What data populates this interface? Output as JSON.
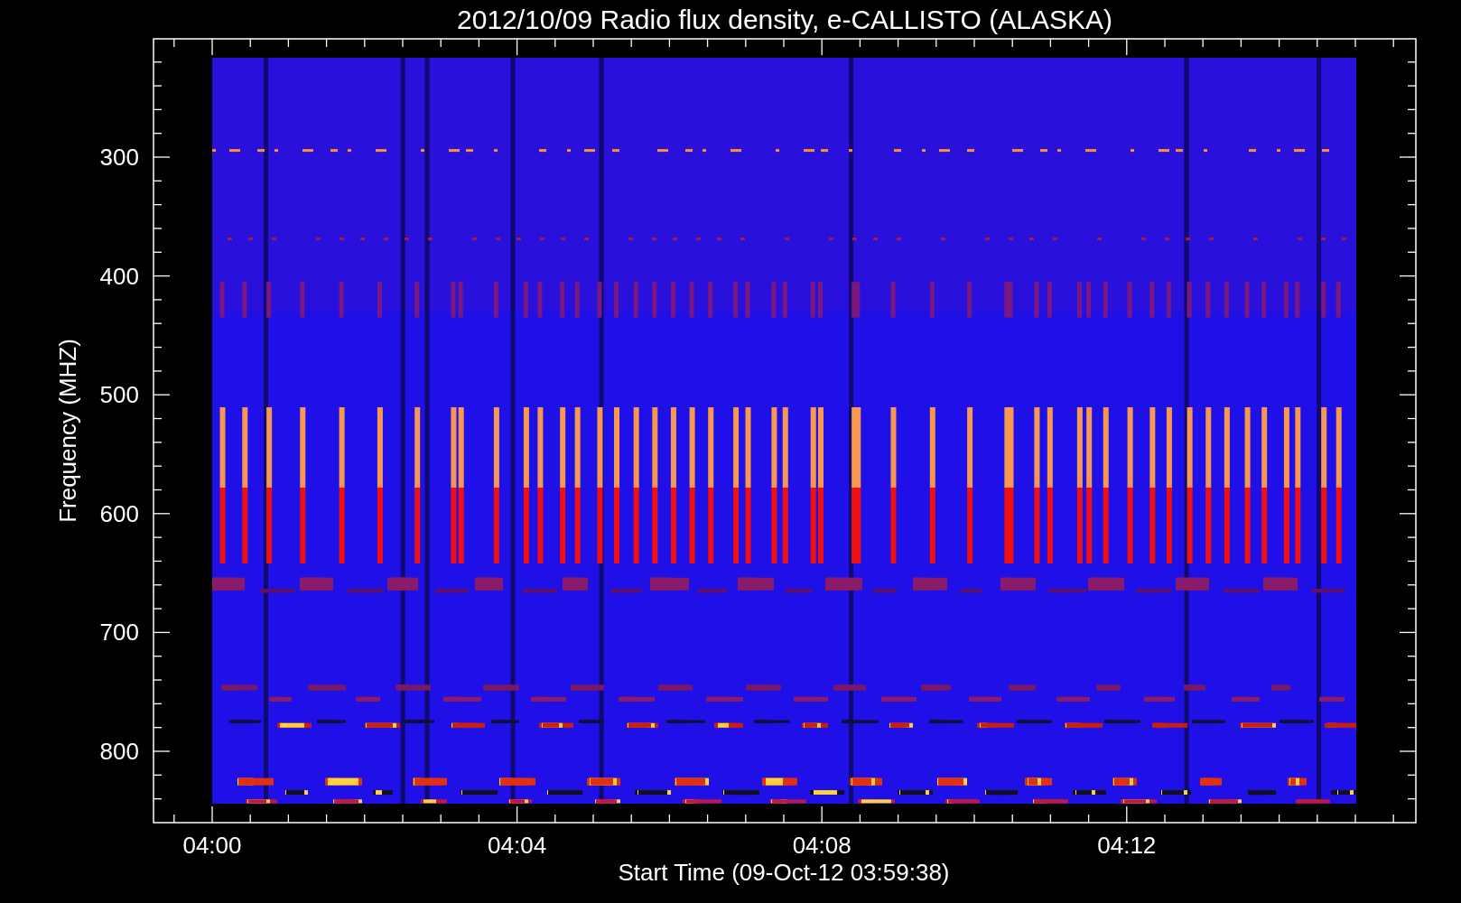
{
  "plot": {
    "title": "2012/10/09  Radio flux density, e-CALLISTO (ALASKA)",
    "xlabel": "Start Time (09-Oct-12 03:59:38)",
    "ylabel": "Frequency (MHZ)",
    "xticks": [
      "04:00",
      "04:04",
      "04:08",
      "04:12"
    ],
    "yticks": [
      "300",
      "400",
      "500",
      "600",
      "700",
      "800"
    ]
  }
}
